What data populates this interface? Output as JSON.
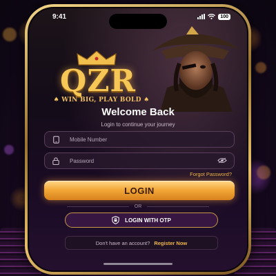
{
  "status_bar": {
    "time": "9:41",
    "battery": "100"
  },
  "brand": {
    "logo": "QZR",
    "tagline": "WIN BIG, PLAY BOLD",
    "accent_color": "#f3a93a"
  },
  "login": {
    "title": "Welcome Back",
    "subtitle": "Login to continue your journey",
    "mobile_placeholder": "Mobile Number",
    "password_placeholder": "Password",
    "forgot_password": "Forgot Password?",
    "login_button": "LOGIN",
    "divider": "OR",
    "otp_button": "LOGIN WITH OTP",
    "no_account": "Don't have an account?",
    "register_link": "Register Now"
  },
  "icons": {
    "mobile": "phone-icon",
    "password": "lock-icon",
    "visibility": "eye-icon",
    "otp": "shield-lock-icon",
    "crown": "crown-icon"
  }
}
